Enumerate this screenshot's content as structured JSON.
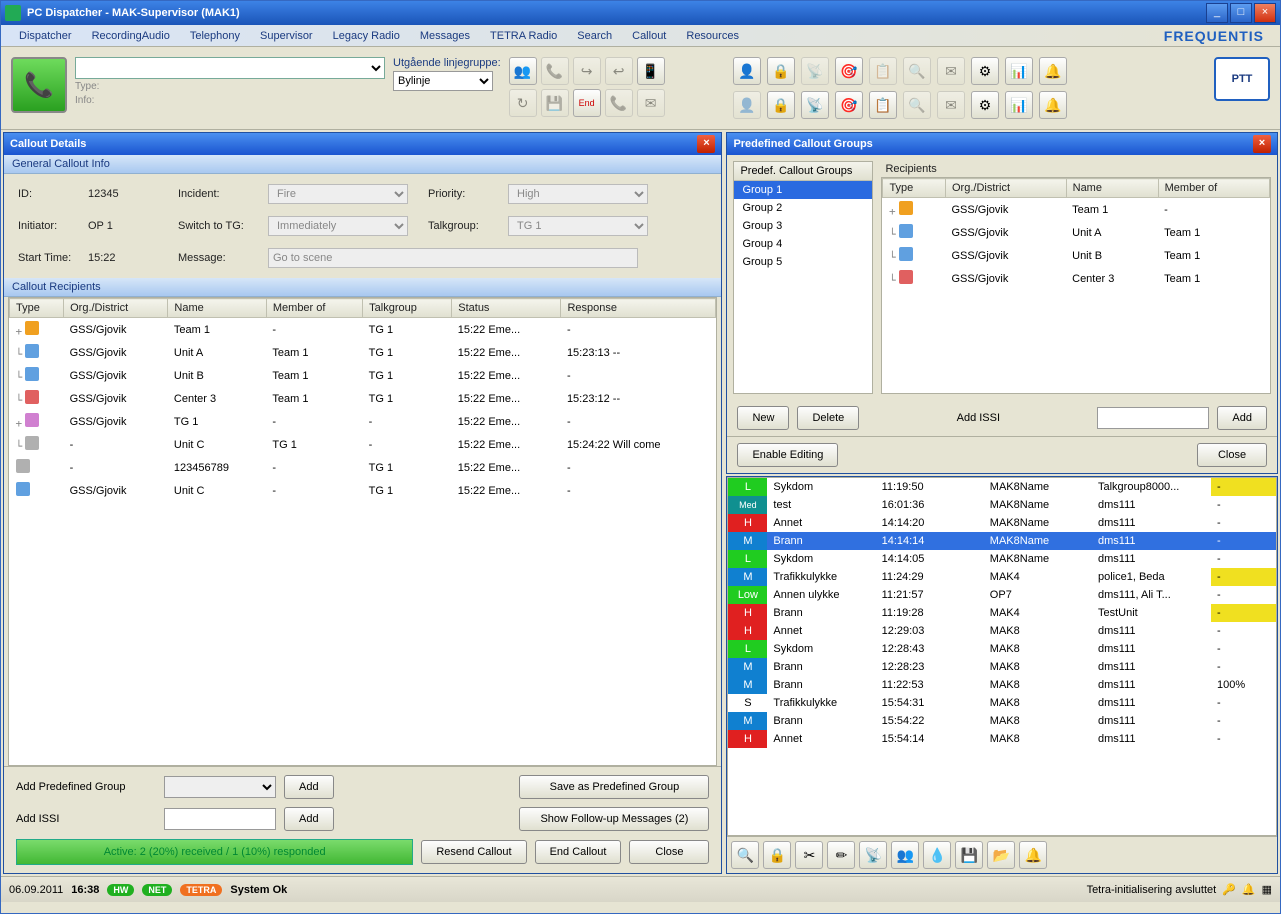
{
  "window": {
    "title": "PC Dispatcher  -  MAK-Supervisor (MAK1)"
  },
  "menu": [
    "Dispatcher",
    "RecordingAudio",
    "Telephony",
    "Supervisor",
    "Legacy Radio",
    "Messages",
    "TETRA Radio",
    "Search",
    "Callout",
    "Resources"
  ],
  "brand": "FREQUENTIS",
  "toolbar": {
    "type_label": "Type:",
    "info_label": "Info:",
    "outgoing_label": "Utgående linjegruppe:",
    "bylinje": "Bylinje",
    "end": "End",
    "ptt": "PTT"
  },
  "callout": {
    "panel_title": "Callout Details",
    "general": "General Callout Info",
    "id_l": "ID:",
    "id_v": "12345",
    "incident_l": "Incident:",
    "incident_v": "Fire",
    "priority_l": "Priority:",
    "priority_v": "High",
    "initiator_l": "Initiator:",
    "initiator_v": "OP 1",
    "switch_l": "Switch to TG:",
    "switch_v": "Immediately",
    "tg_l": "Talkgroup:",
    "tg_v": "TG 1",
    "start_l": "Start Time:",
    "start_v": "15:22",
    "msg_l": "Message:",
    "msg_v": "Go to scene",
    "recip_header": "Callout Recipients",
    "cols": [
      "Type",
      "Org./District",
      "Name",
      "Member of",
      "Talkgroup",
      "Status",
      "Response"
    ],
    "rows": [
      {
        "exp": "+",
        "ico": "team",
        "org": "GSS/Gjovik",
        "name": "Team 1",
        "mem": "-",
        "tg": "TG 1",
        "st": "15:22 Eme...",
        "resp": "-"
      },
      {
        "exp": "└",
        "ico": "car",
        "org": "GSS/Gjovik",
        "name": "Unit A",
        "mem": "Team 1",
        "tg": "TG 1",
        "st": "15:22 Eme...",
        "resp": "15:23:13  --"
      },
      {
        "exp": "└",
        "ico": "car",
        "org": "GSS/Gjovik",
        "name": "Unit B",
        "mem": "Team 1",
        "tg": "TG 1",
        "st": "15:22 Eme...",
        "resp": "-"
      },
      {
        "exp": "└",
        "ico": "house",
        "org": "GSS/Gjovik",
        "name": "Center 3",
        "mem": "Team 1",
        "tg": "TG 1",
        "st": "15:22 Eme...",
        "resp": "15:23:12  --"
      },
      {
        "exp": "+",
        "ico": "tg",
        "org": "GSS/Gjovik",
        "name": "TG 1",
        "mem": "-",
        "tg": "-",
        "st": "15:22 Eme...",
        "resp": "-"
      },
      {
        "exp": "└",
        "ico": "mob",
        "org": "-",
        "name": "Unit C",
        "mem": "TG 1",
        "tg": "-",
        "st": "15:22 Eme...",
        "resp": "15:24:22 Will come"
      },
      {
        "exp": "",
        "ico": "mob",
        "org": "-",
        "name": "123456789",
        "mem": "-",
        "tg": "TG 1",
        "st": "15:22 Eme...",
        "resp": "-"
      },
      {
        "exp": "",
        "ico": "car",
        "org": "GSS/Gjovik",
        "name": "Unit C",
        "mem": "-",
        "tg": "TG 1",
        "st": "15:22 Eme...",
        "resp": "-"
      }
    ],
    "add_group_l": "Add Predefined Group",
    "add_btn": "Add",
    "add_issi_l": "Add ISSI",
    "save_group_btn": "Save as Predefined Group",
    "followup_btn": "Show Follow-up Messages (2)",
    "active_status": "Active: 2 (20%) received / 1 (10%) responded",
    "resend_btn": "Resend Callout",
    "end_btn": "End Callout",
    "close_btn": "Close"
  },
  "predef": {
    "panel_title": "Predefined Callout Groups",
    "groups_hdr": "Predef. Callout Groups",
    "recip_hdr": "Recipients",
    "groups": [
      "Group 1",
      "Group 2",
      "Group 3",
      "Group 4",
      "Group 5"
    ],
    "selected": 0,
    "cols": [
      "Type",
      "Org./District",
      "Name",
      "Member of"
    ],
    "rows": [
      {
        "exp": "+",
        "ico": "team",
        "org": "GSS/Gjovik",
        "name": "Team 1",
        "mem": "-"
      },
      {
        "exp": "└",
        "ico": "car",
        "org": "GSS/Gjovik",
        "name": "Unit A",
        "mem": "Team 1"
      },
      {
        "exp": "└",
        "ico": "car",
        "org": "GSS/Gjovik",
        "name": "Unit B",
        "mem": "Team 1"
      },
      {
        "exp": "└",
        "ico": "house",
        "org": "GSS/Gjovik",
        "name": "Center 3",
        "mem": "Team 1"
      }
    ],
    "new_btn": "New",
    "delete_btn": "Delete",
    "add_issi_l": "Add ISSI",
    "add_btn": "Add",
    "enable_btn": "Enable Editing",
    "close_btn": "Close"
  },
  "events": {
    "selected": 3,
    "rows": [
      {
        "p": "L",
        "t": "Sykdom",
        "time": "11:19:50",
        "op": "MAK8Name",
        "tg": "Talkgroup8000...",
        "last": "-",
        "hi": true
      },
      {
        "p": "Med",
        "t": "test",
        "time": "16:01:36",
        "op": "MAK8Name",
        "tg": "dms111",
        "last": "-"
      },
      {
        "p": "H",
        "t": "Annet",
        "time": "14:14:20",
        "op": "MAK8Name",
        "tg": "dms111",
        "last": "-"
      },
      {
        "p": "M",
        "t": "Brann",
        "time": "14:14:14",
        "op": "MAK8Name",
        "tg": "dms111",
        "last": "-"
      },
      {
        "p": "L",
        "t": "Sykdom",
        "time": "14:14:05",
        "op": "MAK8Name",
        "tg": "dms111",
        "last": "-"
      },
      {
        "p": "M",
        "t": "Trafikkulykke",
        "time": "11:24:29",
        "op": "MAK4",
        "tg": "police1, Beda",
        "last": "-",
        "hi": true
      },
      {
        "p": "Low",
        "t": "Annen ulykke",
        "time": "11:21:57",
        "op": "OP7",
        "tg": "dms111, Ali T...",
        "last": "-"
      },
      {
        "p": "H",
        "t": "Brann",
        "time": "11:19:28",
        "op": "MAK4",
        "tg": "TestUnit",
        "last": "-",
        "hi": true
      },
      {
        "p": "H",
        "t": "Annet",
        "time": "12:29:03",
        "op": "MAK8",
        "tg": "dms111",
        "last": "-"
      },
      {
        "p": "L",
        "t": "Sykdom",
        "time": "12:28:43",
        "op": "MAK8",
        "tg": "dms111",
        "last": "-"
      },
      {
        "p": "M",
        "t": "Brann",
        "time": "12:28:23",
        "op": "MAK8",
        "tg": "dms111",
        "last": "-"
      },
      {
        "p": "M",
        "t": "Brann",
        "time": "11:22:53",
        "op": "MAK8",
        "tg": "dms111",
        "last": "100%"
      },
      {
        "p": "S",
        "t": "Trafikkulykke",
        "time": "15:54:31",
        "op": "MAK8",
        "tg": "dms111",
        "last": "-"
      },
      {
        "p": "M",
        "t": "Brann",
        "time": "15:54:22",
        "op": "MAK8",
        "tg": "dms111",
        "last": "-"
      },
      {
        "p": "H",
        "t": "Annet",
        "time": "15:54:14",
        "op": "MAK8",
        "tg": "dms111",
        "last": "-"
      }
    ]
  },
  "status": {
    "date": "06.09.2011",
    "time": "16:38",
    "hw": "HW",
    "net": "NET",
    "tetra": "TETRA",
    "systext": "System Ok",
    "rtext": "Tetra-initialisering avsluttet"
  }
}
